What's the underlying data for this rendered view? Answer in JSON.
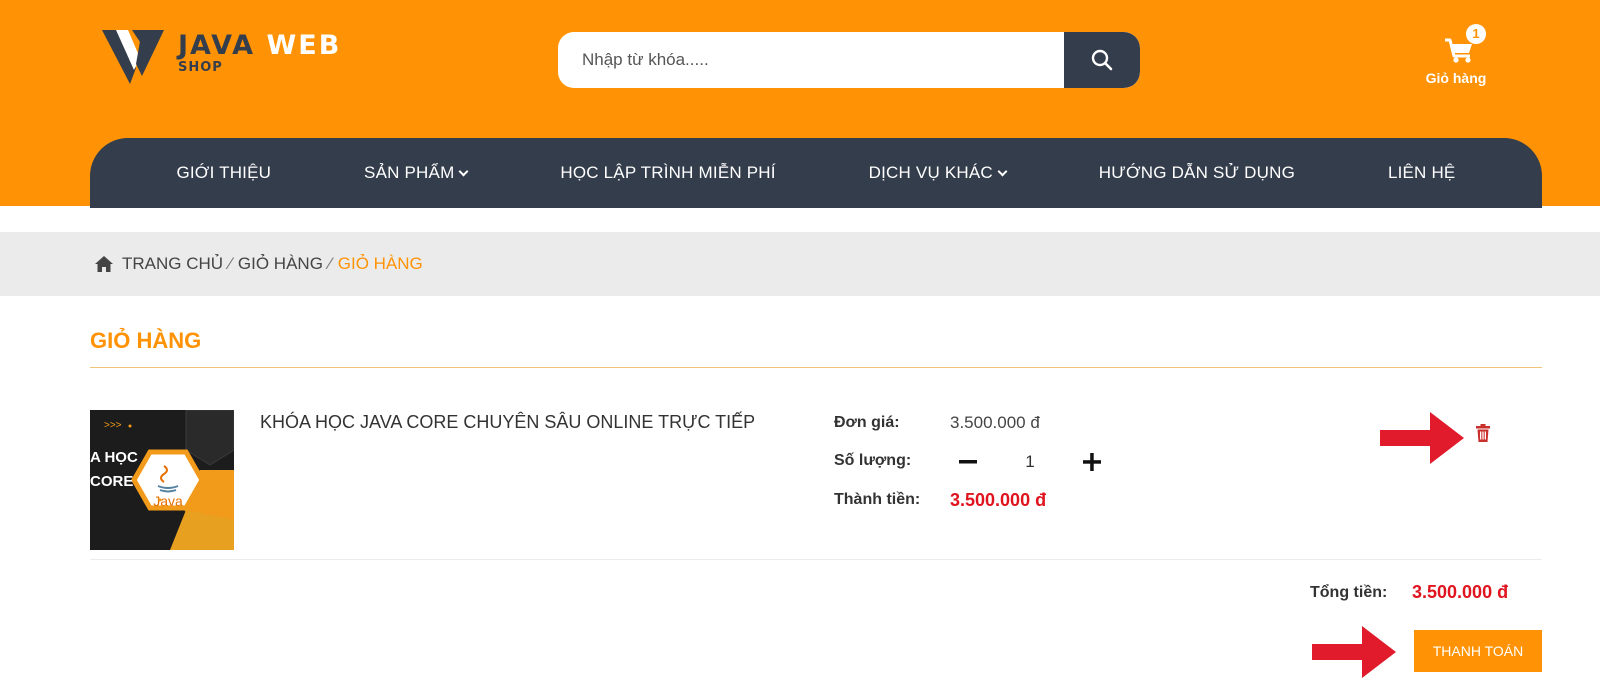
{
  "brand": {
    "name_part1": "JAVA",
    "name_part2": "WEB",
    "sub": "SHOP"
  },
  "search": {
    "placeholder": "Nhập từ khóa....."
  },
  "cart": {
    "count": "1",
    "label": "Giỏ hàng"
  },
  "nav": [
    {
      "label": "GIỚI THIỆU",
      "dropdown": false
    },
    {
      "label": "SẢN PHẨM",
      "dropdown": true
    },
    {
      "label": "HỌC LẬP TRÌNH MIỄN PHÍ",
      "dropdown": false
    },
    {
      "label": "DỊCH VỤ KHÁC",
      "dropdown": true
    },
    {
      "label": "HƯỚNG DẪN SỬ DỤNG",
      "dropdown": false
    },
    {
      "label": "LIÊN HỆ",
      "dropdown": false
    }
  ],
  "breadcrumb": {
    "home": "TRANG CHỦ",
    "mid": "GIỎ HÀNG",
    "current": "GIỎ HÀNG",
    "separator": "⁄"
  },
  "page": {
    "title": "GIỎ HÀNG"
  },
  "item": {
    "thumb_text_line1": "A HỌC",
    "thumb_text_line2": "CORE",
    "thumb_logo": "Java",
    "name": "KHÓA HỌC JAVA CORE CHUYÊN SÂU ONLINE TRỰC TIẾP",
    "unit_price_label": "Đơn giá:",
    "unit_price": "3.500.000 đ",
    "qty_label": "Số lượng:",
    "qty": "1",
    "subtotal_label": "Thành tiền:",
    "subtotal": "3.500.000 đ"
  },
  "summary": {
    "total_label": "Tổng tiền:",
    "total": "3.500.000 đ",
    "checkout_label": "THANH TOÁN"
  },
  "colors": {
    "brand_orange": "#ff9305",
    "nav_dark": "#343d4c",
    "price_red": "#e0141e",
    "annotation_red": "#e21b2c"
  }
}
